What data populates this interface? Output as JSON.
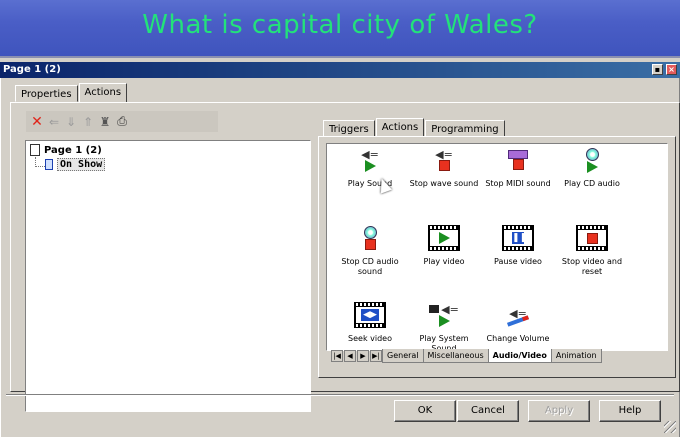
{
  "banner": {
    "title": "What is capital city of Wales?",
    "text_color": "#23e27a",
    "bg_color": "#4a5ec6"
  },
  "window": {
    "title": "Page 1 (2)",
    "minimize_icon": "minimize-icon",
    "close_icon": "close-icon"
  },
  "top_tabs": [
    {
      "label": "Properties",
      "active": false
    },
    {
      "label": "Actions",
      "active": true
    }
  ],
  "toolbar": {
    "icons": [
      "delete-icon",
      "arrow-left-icon",
      "arrow-down-icon",
      "arrow-up-icon",
      "tree-icon",
      "print-icon"
    ]
  },
  "tree": {
    "root_label": "Page 1 (2)",
    "child_label": "On Show"
  },
  "right_tabs": [
    {
      "label": "Triggers",
      "active": false
    },
    {
      "label": "Actions",
      "active": true
    },
    {
      "label": "Programming",
      "active": false
    }
  ],
  "actions": [
    {
      "label": "Play Sound",
      "icon": "speaker-play-icon"
    },
    {
      "label": "Stop wave sound",
      "icon": "speaker-stop-icon"
    },
    {
      "label": "Stop MIDI sound",
      "icon": "midi-stop-icon"
    },
    {
      "label": "Play CD audio",
      "icon": "cd-play-icon"
    },
    {
      "label": "Stop CD audio sound",
      "icon": "cd-stop-icon"
    },
    {
      "label": "Play video",
      "icon": "film-play-icon"
    },
    {
      "label": "Pause video",
      "icon": "film-pause-icon"
    },
    {
      "label": "Stop video and reset",
      "icon": "film-stop-icon"
    },
    {
      "label": "Seek video",
      "icon": "film-seek-icon"
    },
    {
      "label": "Play System Sound",
      "icon": "system-sound-icon"
    },
    {
      "label": "Change Volume",
      "icon": "volume-icon"
    }
  ],
  "bottom_tabs": [
    {
      "label": "General",
      "active": false
    },
    {
      "label": "Miscellaneous",
      "active": false
    },
    {
      "label": "Audio/Video",
      "active": true
    },
    {
      "label": "Animation",
      "active": false
    }
  ],
  "buttons": {
    "ok": "OK",
    "cancel": "Cancel",
    "apply": "Apply",
    "help": "Help"
  }
}
